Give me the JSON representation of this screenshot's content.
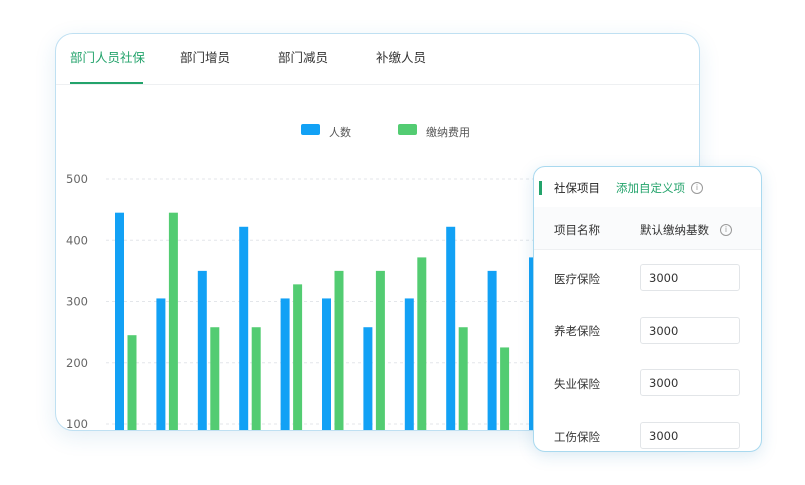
{
  "tabs": [
    {
      "label": "部门人员社保",
      "active": true
    },
    {
      "label": "部门增员",
      "active": false
    },
    {
      "label": "部门减员",
      "active": false
    },
    {
      "label": "补缴人员",
      "active": false
    }
  ],
  "colors": {
    "accent": "#23a36b",
    "series_people": "#12a1f5",
    "series_fee": "#53cc72"
  },
  "chart_data": {
    "type": "bar",
    "categories": [
      "",
      "",
      "",
      "",
      "",
      "",
      "",
      "",
      "",
      "",
      ""
    ],
    "series": [
      {
        "name": "人数",
        "values": [
          445,
          305,
          350,
          422,
          305,
          305,
          258,
          305,
          422,
          350,
          372
        ]
      },
      {
        "name": "缴纳费用",
        "values": [
          245,
          445,
          258,
          258,
          328,
          350,
          350,
          372,
          258,
          225,
          0
        ]
      }
    ],
    "ylim": [
      100,
      500
    ],
    "yticks": [
      100,
      200,
      300,
      400,
      500
    ],
    "grid": true,
    "legend": "top-center"
  },
  "panel": {
    "title": "社保项目",
    "add_link": "添加自定义项",
    "col_name": "项目名称",
    "col_base": "默认缴纳基数",
    "rows": [
      {
        "label": "医疗保险",
        "value": "3000"
      },
      {
        "label": "养老保险",
        "value": "3000"
      },
      {
        "label": "失业保险",
        "value": "3000"
      },
      {
        "label": "工伤保险",
        "value": "3000"
      }
    ]
  }
}
